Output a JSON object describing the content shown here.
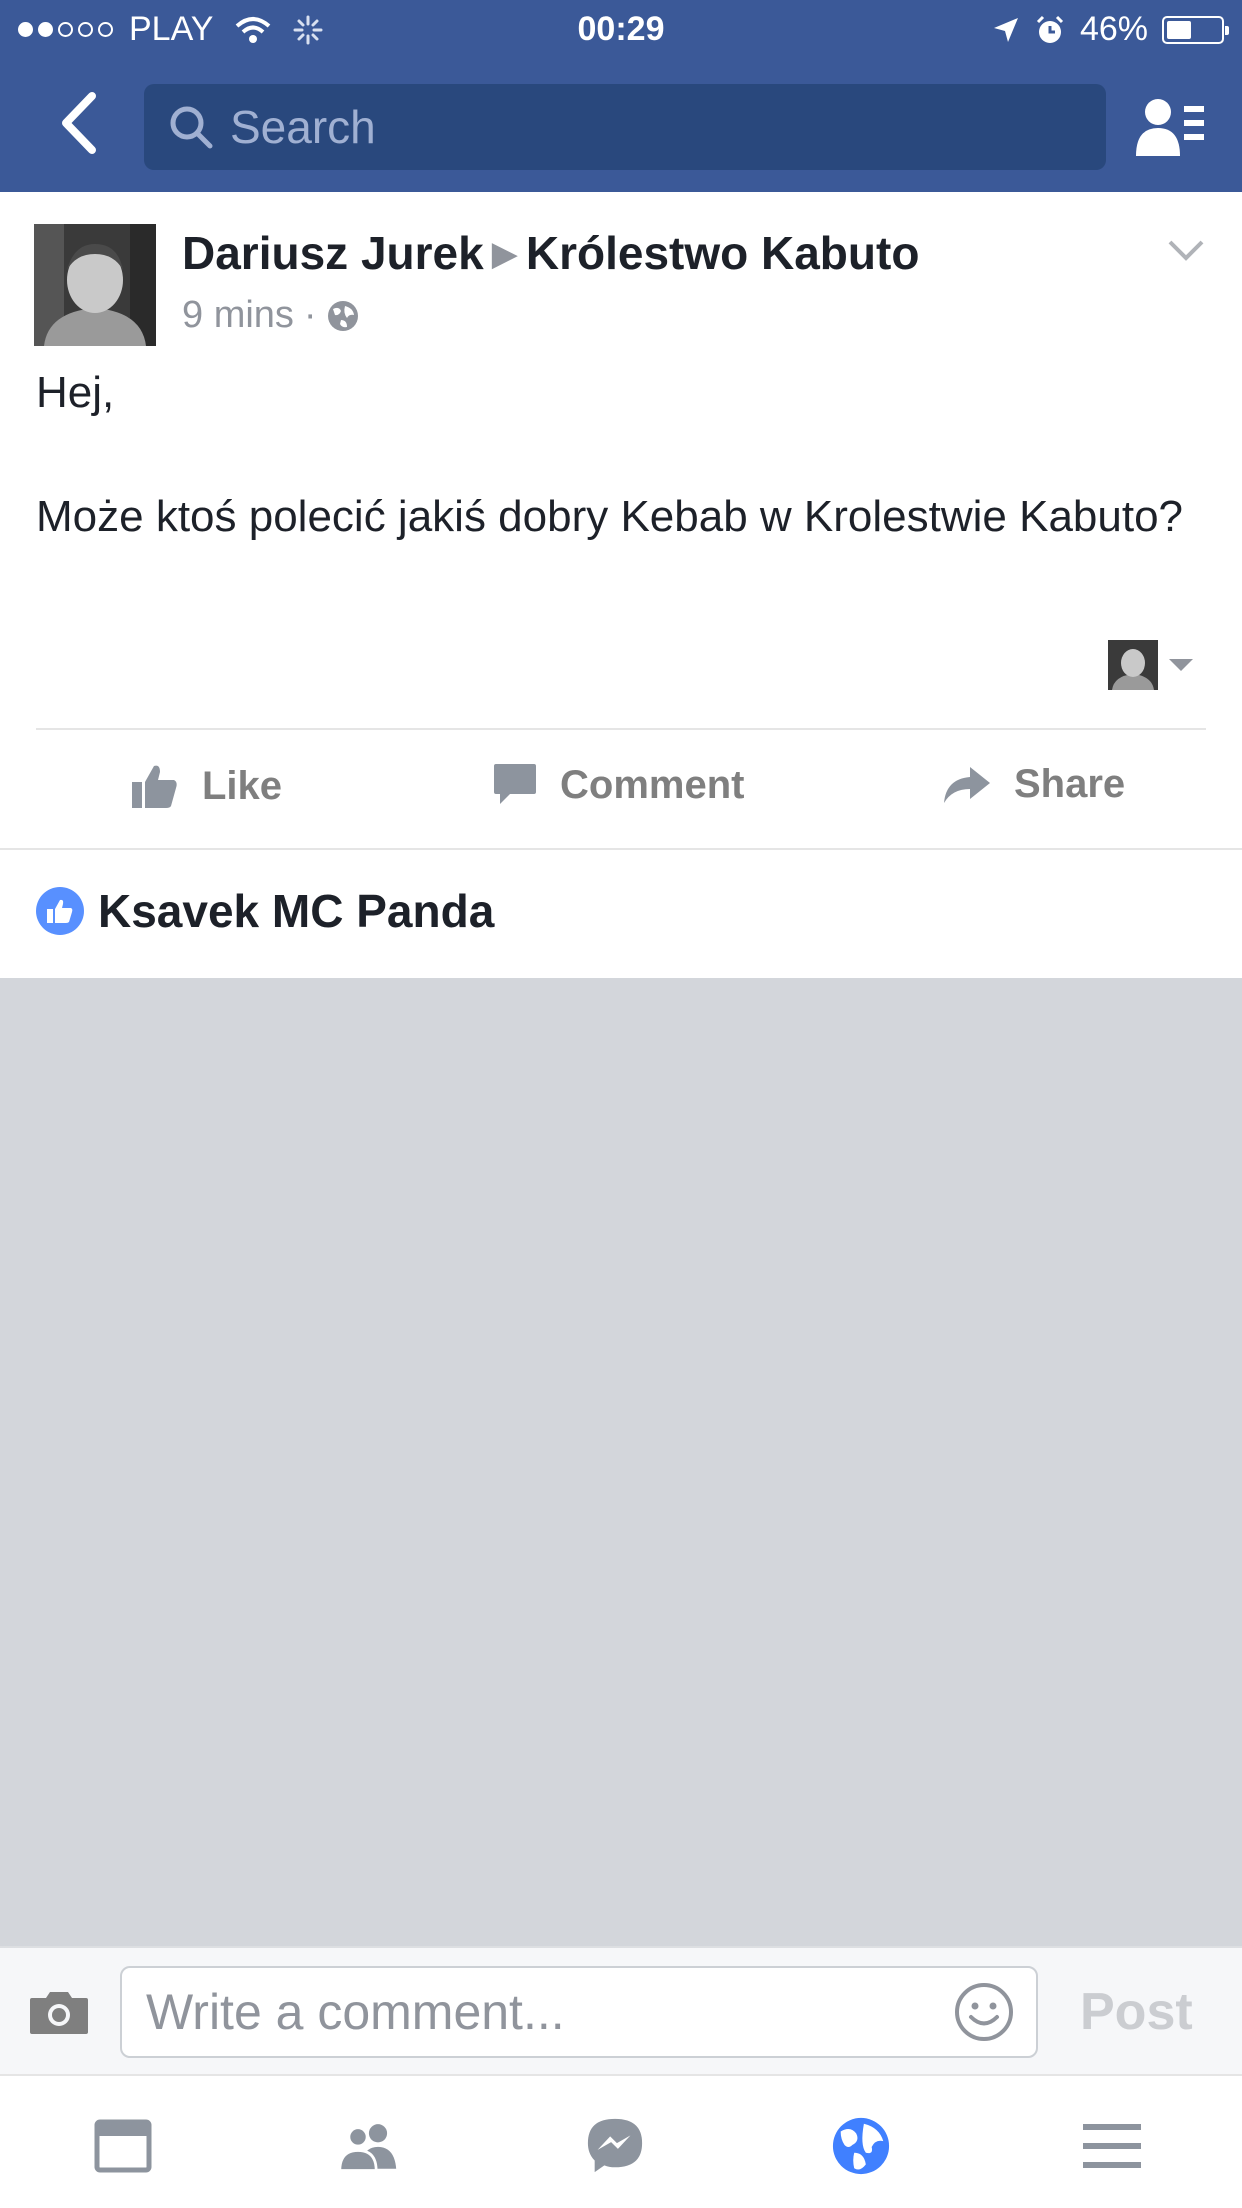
{
  "status_bar": {
    "carrier": "PLAY",
    "time": "00:29",
    "battery": "46%",
    "battery_level": 0.46,
    "signal_bars_filled": 2,
    "signal_bars_total": 5
  },
  "header": {
    "search_placeholder": "Search",
    "icons": [
      "back-chevron-icon",
      "search-icon",
      "friends-list-icon"
    ]
  },
  "post": {
    "author": "Dariusz Jurek",
    "group": "Królestwo Kabuto",
    "time": "9 mins",
    "privacy_icon": "globe-icon",
    "text_lines": [
      "Hej,",
      "",
      "Może ktoś polecić jakiś dobry Kebab w Krolestwie Kabuto?"
    ]
  },
  "actions": {
    "like": "Like",
    "comment": "Comment",
    "share": "Share"
  },
  "likes": {
    "liker": "Ksavek MC Panda"
  },
  "comment_bar": {
    "placeholder": "Write a comment...",
    "post_label": "Post"
  },
  "tabs": [
    "news-feed-icon",
    "friends-icon",
    "messenger-icon",
    "notifications-globe-icon",
    "menu-icon"
  ],
  "colors": {
    "brand_blue": "#3b5998",
    "search_bg": "#29487d",
    "active_tab": "#4080ff",
    "inactive_gray": "#90949c",
    "feed_gray": "#d3d6db"
  }
}
